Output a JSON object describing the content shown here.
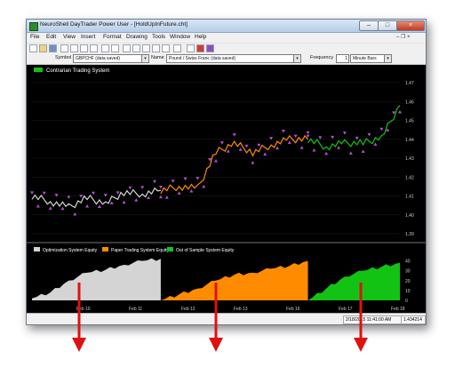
{
  "window": {
    "title": "NeuroShell DayTrader Power User - [HoldUpInFuture.cht]",
    "min_label": "–",
    "max_label": "□",
    "close_label": "×"
  },
  "menu": {
    "items": [
      "File",
      "Edit",
      "View",
      "Insert",
      "Format",
      "Drawing",
      "Tools",
      "Window",
      "Help"
    ],
    "doc_controls": "– ❐ ×"
  },
  "symbol_bar": {
    "symbol_label": "Symbol",
    "symbol_value": "GBPCHF (data saved)",
    "name_label": "Name",
    "name_value": "Pound / Swiss Franc (data saved)",
    "frequency_label": "Frequency",
    "frequency_value": "1",
    "frequency_unit": "Minute Bars"
  },
  "colors": {
    "optimization": "#d4d4d4",
    "paper_trading": "#ff8c00",
    "out_of_sample": "#13c313",
    "markers": "#b44fd0",
    "arrow": "#e01010"
  },
  "chart_data": [
    {
      "type": "line",
      "title": "Contrarian Trading System",
      "ylim": [
        1.39,
        1.47
      ],
      "y_ticks": [
        "1.47",
        "1.46",
        "1.45",
        "1.44",
        "1.43",
        "1.42",
        "1.41",
        "1.40",
        "1.39"
      ],
      "series": [
        {
          "name": "",
          "segment": "Optimization",
          "x": [
            0,
            5,
            10,
            15,
            20,
            25,
            30,
            35
          ],
          "values": [
            1.41,
            1.407,
            1.404,
            1.409,
            1.406,
            1.412,
            1.411,
            1.413
          ]
        },
        {
          "name": "",
          "segment": "Paper Trading",
          "x": [
            35,
            40,
            45,
            50,
            55,
            60,
            65,
            70,
            75
          ],
          "values": [
            1.413,
            1.415,
            1.414,
            1.433,
            1.438,
            1.433,
            1.437,
            1.44,
            1.44
          ]
        },
        {
          "name": "",
          "segment": "Out of Sample",
          "x": [
            75,
            80,
            85,
            90,
            95,
            100
          ],
          "values": [
            1.44,
            1.436,
            1.438,
            1.438,
            1.441,
            1.458
          ]
        }
      ]
    },
    {
      "type": "area",
      "ylim": [
        0,
        45
      ],
      "y_ticks": [
        "40",
        "30",
        "20",
        "10",
        "0"
      ],
      "x_tick_labels": [
        "Feb 10",
        "Feb 11",
        "Feb 12",
        "Feb 13",
        "Feb 16",
        "Feb 17",
        "Feb 18"
      ],
      "series": [
        {
          "name": "Optimization System Equity",
          "x": [
            0,
            5,
            10,
            15,
            20,
            25,
            30,
            35
          ],
          "values": [
            2,
            8,
            20,
            28,
            31,
            36,
            40,
            42
          ]
        },
        {
          "name": "Paper Trading System Equity",
          "x": [
            35,
            40,
            45,
            50,
            55,
            60,
            65,
            70,
            75
          ],
          "values": [
            0,
            6,
            12,
            20,
            26,
            28,
            32,
            35,
            40
          ]
        },
        {
          "name": "Out of Sample System Equity",
          "x": [
            75,
            80,
            85,
            90,
            95,
            100
          ],
          "values": [
            0,
            12,
            24,
            30,
            34,
            38
          ]
        }
      ]
    }
  ],
  "status": {
    "datetime": "2/18/2015 11:41:00 AM",
    "value": "1.434214"
  }
}
